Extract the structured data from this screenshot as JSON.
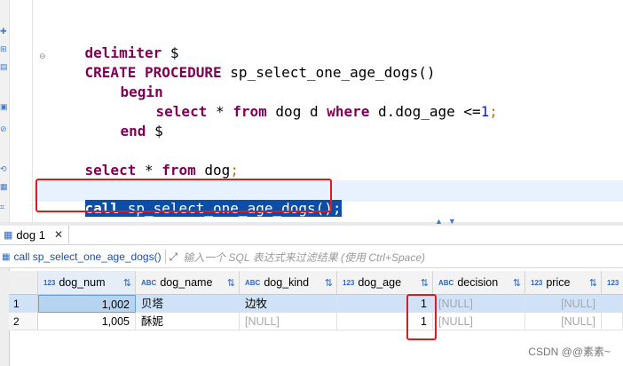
{
  "editor": {
    "lines": {
      "delimiter_kw": "delimiter",
      "delimiter_sym": "$",
      "create_kw": "CREATE PROCEDURE",
      "proc_sig": "sp_select_one_age_dogs()",
      "begin_kw": "begin",
      "select_kw": "select",
      "star": "*",
      "from_kw": "from",
      "table_alias": "dog d",
      "where_kw": "where",
      "cond": "d.dog_age <=",
      "cond_val": "1",
      "semi": ";",
      "end_kw": "end",
      "end_sym": "$",
      "select2_kw": "select",
      "from2_kw": "from",
      "table2": "dog",
      "call_kw": "call",
      "call_rest": "sp_select_one_age_dogs();"
    }
  },
  "results": {
    "tab_label": "dog 1",
    "query_text": "call sp_select_one_age_dogs()",
    "filter_placeholder": "输入一个 SQL 表达式来过滤结果 (使用 Ctrl+Space)",
    "columns": [
      {
        "type": "123",
        "name": "dog_num"
      },
      {
        "type": "ABC",
        "name": "dog_name"
      },
      {
        "type": "ABC",
        "name": "dog_kind"
      },
      {
        "type": "123",
        "name": "dog_age"
      },
      {
        "type": "ABC",
        "name": "decision"
      },
      {
        "type": "123",
        "name": "price"
      },
      {
        "type": "123",
        "name": ""
      }
    ],
    "rows": [
      {
        "num": "1",
        "dog_num": "1,002",
        "dog_name": "贝塔",
        "dog_kind": "边牧",
        "dog_age": "1",
        "decision": "[NULL]",
        "price": "[NULL]"
      },
      {
        "num": "2",
        "dog_num": "1,005",
        "dog_name": "酥妮",
        "dog_kind": "[NULL]",
        "dog_age": "1",
        "decision": "[NULL]",
        "price": "[NULL]"
      }
    ]
  },
  "watermark": "CSDN @@素素~",
  "colors": {
    "highlight": "#e0191e",
    "keyword": "#7f0055",
    "selection": "#0a4ea8"
  }
}
